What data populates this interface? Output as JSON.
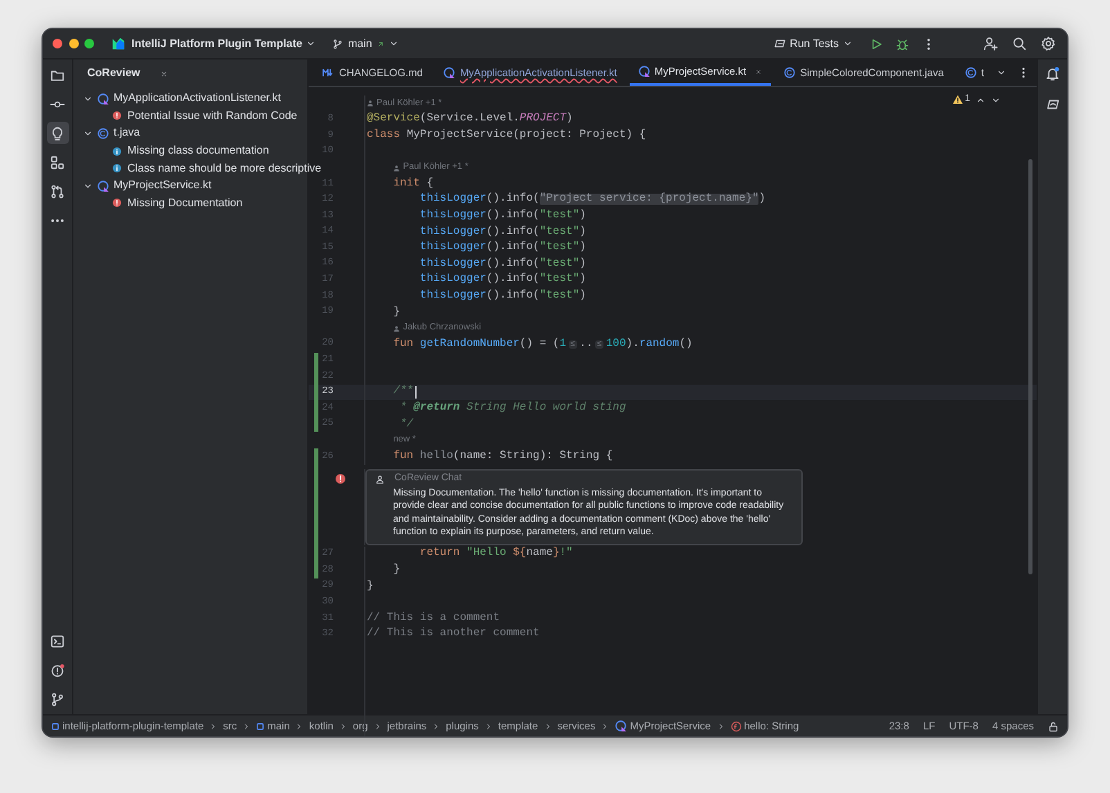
{
  "window": {
    "project": "IntelliJ Platform Plugin Template",
    "branch": "main",
    "run_config": "Run Tests"
  },
  "left_stripe": {
    "top": [
      {
        "kind": "folder",
        "selected": false
      },
      {
        "kind": "commit",
        "selected": false
      },
      {
        "kind": "bulb",
        "selected": true
      },
      {
        "kind": "structure",
        "selected": false
      },
      {
        "kind": "pull",
        "selected": false
      },
      {
        "kind": "more",
        "selected": false
      }
    ],
    "bottom": [
      {
        "kind": "terminal",
        "selected": false
      },
      {
        "kind": "problems",
        "selected": false
      },
      {
        "kind": "git",
        "selected": false
      }
    ]
  },
  "tool_window": {
    "title": "CoReview",
    "tree": [
      {
        "label": "MyApplicationActivationListener.kt",
        "kind": "kotlin",
        "expanded": true,
        "children": [
          {
            "label": "Potential Issue with Random Code",
            "kind": "error"
          }
        ]
      },
      {
        "label": "t.java",
        "kind": "java",
        "expanded": true,
        "children": [
          {
            "label": "Missing class documentation",
            "kind": "info"
          },
          {
            "label": "Class name should be more descriptive",
            "kind": "info"
          }
        ]
      },
      {
        "label": "MyProjectService.kt",
        "kind": "kotlin",
        "expanded": true,
        "children": [
          {
            "label": "Missing Documentation",
            "kind": "error"
          }
        ]
      }
    ]
  },
  "tabs": [
    {
      "label": "CHANGELOG.md",
      "kind": "markdown",
      "selected": false,
      "has_error": false
    },
    {
      "label": "MyApplicationActivationListener.kt",
      "kind": "kotlin",
      "selected": false,
      "has_error": true
    },
    {
      "label": "MyProjectService.kt",
      "kind": "kotlin",
      "selected": true,
      "has_error": false
    },
    {
      "label": "SimpleColoredComponent.java",
      "kind": "java",
      "selected": false,
      "has_error": false
    },
    {
      "label": "t",
      "kind": "java",
      "selected": false,
      "has_error": false
    }
  ],
  "editor": {
    "warnings": "1",
    "lines": [
      {
        "kind": "author",
        "text": "Paul Köhler +1 *"
      },
      {
        "kind": "code",
        "number": "8",
        "changed": false,
        "current": false,
        "tokens": [
          {
            "text": "@Service",
            "kind": "annotation"
          },
          {
            "text": "(Service.Level.",
            "kind": "plain"
          },
          {
            "text": "PROJECT",
            "kind": "constant"
          },
          {
            "text": ")",
            "kind": "plain"
          }
        ]
      },
      {
        "kind": "code",
        "number": "9",
        "changed": false,
        "current": false,
        "tokens": [
          {
            "text": "class ",
            "kind": "keyword"
          },
          {
            "text": "MyProjectService(project: Project) {",
            "kind": "plain"
          }
        ]
      },
      {
        "kind": "code",
        "number": "10",
        "changed": false,
        "current": false
      },
      {
        "kind": "author",
        "text": "Paul Köhler +1 *"
      },
      {
        "kind": "code",
        "number": "11",
        "changed": false,
        "current": false,
        "tokens": [
          {
            "text": "    init ",
            "kind": "keyword"
          },
          {
            "text": "{",
            "kind": "plain"
          }
        ]
      },
      {
        "kind": "code",
        "number": "12",
        "changed": false,
        "current": false,
        "tokens": [
          {
            "text": "        thisLogger",
            "kind": "call"
          },
          {
            "text": "().info(",
            "kind": "plain"
          },
          {
            "text": "\"Project service: {project.name}\"",
            "kind": "string-hl"
          },
          {
            "text": ")",
            "kind": "plain"
          }
        ]
      },
      {
        "kind": "code",
        "number": "13",
        "changed": false,
        "current": false,
        "tokens": [
          {
            "text": "        thisLogger",
            "kind": "call"
          },
          {
            "text": "().info(",
            "kind": "plain"
          },
          {
            "text": "\"test\"",
            "kind": "string"
          },
          {
            "text": ")",
            "kind": "plain"
          }
        ]
      },
      {
        "kind": "code",
        "number": "14",
        "changed": false,
        "current": false,
        "tokens": [
          {
            "text": "        thisLogger",
            "kind": "call"
          },
          {
            "text": "().info(",
            "kind": "plain"
          },
          {
            "text": "\"test\"",
            "kind": "string"
          },
          {
            "text": ")",
            "kind": "plain"
          }
        ]
      },
      {
        "kind": "code",
        "number": "15",
        "changed": false,
        "current": false,
        "tokens": [
          {
            "text": "        thisLogger",
            "kind": "call"
          },
          {
            "text": "().info(",
            "kind": "plain"
          },
          {
            "text": "\"test\"",
            "kind": "string"
          },
          {
            "text": ")",
            "kind": "plain"
          }
        ]
      },
      {
        "kind": "code",
        "number": "16",
        "changed": false,
        "current": false,
        "tokens": [
          {
            "text": "        thisLogger",
            "kind": "call"
          },
          {
            "text": "().info(",
            "kind": "plain"
          },
          {
            "text": "\"test\"",
            "kind": "string"
          },
          {
            "text": ")",
            "kind": "plain"
          }
        ]
      },
      {
        "kind": "code",
        "number": "17",
        "changed": false,
        "current": false,
        "tokens": [
          {
            "text": "        thisLogger",
            "kind": "call"
          },
          {
            "text": "().info(",
            "kind": "plain"
          },
          {
            "text": "\"test\"",
            "kind": "string"
          },
          {
            "text": ")",
            "kind": "plain"
          }
        ]
      },
      {
        "kind": "code",
        "number": "18",
        "changed": false,
        "current": false,
        "tokens": [
          {
            "text": "        thisLogger",
            "kind": "call"
          },
          {
            "text": "().info(",
            "kind": "plain"
          },
          {
            "text": "\"test\"",
            "kind": "string"
          },
          {
            "text": ")",
            "kind": "plain"
          }
        ]
      },
      {
        "kind": "code",
        "number": "19",
        "changed": false,
        "current": false,
        "tokens": [
          {
            "text": "    }",
            "kind": "plain"
          }
        ]
      },
      {
        "kind": "author",
        "text": "Jakub Chrzanowski"
      },
      {
        "kind": "code",
        "number": "20",
        "changed": false,
        "current": false,
        "tokens": [
          {
            "text": "    fun ",
            "kind": "keyword"
          },
          {
            "text": "getRandomNumber",
            "kind": "call"
          },
          {
            "text": "() = (",
            "kind": "plain"
          },
          {
            "text": "1",
            "kind": "number"
          },
          {
            "text": "≤",
            "kind": "hint"
          },
          {
            "text": "..",
            "kind": "plain"
          },
          {
            "text": "≤",
            "kind": "hint"
          },
          {
            "text": "100",
            "kind": "number"
          },
          {
            "text": ").",
            "kind": "plain"
          },
          {
            "text": "random",
            "kind": "call"
          },
          {
            "text": "()",
            "kind": "plain"
          }
        ]
      },
      {
        "kind": "code",
        "number": "21",
        "changed": true,
        "current": false
      },
      {
        "kind": "code",
        "number": "22",
        "changed": true,
        "current": false
      },
      {
        "kind": "code",
        "number": "23",
        "changed": true,
        "current": true,
        "tokens": [
          {
            "text": "    /**",
            "kind": "doc"
          }
        ]
      },
      {
        "kind": "code",
        "number": "24",
        "changed": true,
        "current": false,
        "tokens": [
          {
            "text": "     * ",
            "kind": "doc"
          },
          {
            "text": "@return",
            "kind": "doc-tag"
          },
          {
            "text": " String Hello world sting",
            "kind": "doc"
          }
        ]
      },
      {
        "kind": "code",
        "number": "25",
        "changed": true,
        "current": false,
        "tokens": [
          {
            "text": "     */",
            "kind": "doc"
          }
        ]
      },
      {
        "kind": "note",
        "text": "new *"
      },
      {
        "kind": "code",
        "number": "26",
        "changed": true,
        "current": false,
        "tokens": [
          {
            "text": "    fun ",
            "kind": "keyword"
          },
          {
            "text": "hello",
            "kind": "unused"
          },
          {
            "text": "(name: String): String {",
            "kind": "plain"
          }
        ]
      },
      {
        "kind": "review",
        "has_error": true,
        "title": "CoReview Chat",
        "text": "Missing Documentation. The 'hello' function is missing documentation. It's important to provide clear and concise documentation for all public functions to improve code readability and maintainability. Consider adding a documentation comment (KDoc) above the 'hello' function to explain its purpose, parameters, and return value."
      },
      {
        "kind": "code",
        "number": "27",
        "changed": true,
        "current": false,
        "tokens": [
          {
            "text": "        return ",
            "kind": "keyword"
          },
          {
            "text": "\"Hello ",
            "kind": "string"
          },
          {
            "text": "${",
            "kind": "keyword"
          },
          {
            "text": "name",
            "kind": "plain"
          },
          {
            "text": "}",
            "kind": "keyword"
          },
          {
            "text": "!\"",
            "kind": "string"
          }
        ]
      },
      {
        "kind": "code",
        "number": "28",
        "changed": true,
        "current": false,
        "tokens": [
          {
            "text": "    }",
            "kind": "plain"
          }
        ]
      },
      {
        "kind": "code",
        "number": "29",
        "changed": false,
        "current": false,
        "tokens": [
          {
            "text": "}",
            "kind": "plain"
          }
        ]
      },
      {
        "kind": "code",
        "number": "30",
        "changed": false,
        "current": false
      },
      {
        "kind": "code",
        "number": "31",
        "changed": false,
        "current": false,
        "tokens": [
          {
            "text": "// This is a comment",
            "kind": "comment"
          }
        ]
      },
      {
        "kind": "code",
        "number": "32",
        "changed": false,
        "current": false,
        "tokens": [
          {
            "text": "// This is another comment",
            "kind": "comment"
          }
        ]
      }
    ]
  },
  "status_bar": {
    "breadcrumbs": [
      {
        "text": "intellij-platform-plugin-template",
        "kind": "module"
      },
      {
        "text": "src",
        "kind": "plain"
      },
      {
        "text": "main",
        "kind": "module"
      },
      {
        "text": "kotlin",
        "kind": "plain"
      },
      {
        "text": "org",
        "kind": "plain"
      },
      {
        "text": "jetbrains",
        "kind": "plain"
      },
      {
        "text": "plugins",
        "kind": "plain"
      },
      {
        "text": "template",
        "kind": "plain"
      },
      {
        "text": "services",
        "kind": "plain"
      },
      {
        "text": "MyProjectService",
        "kind": "class"
      },
      {
        "text": "hello: String",
        "kind": "function"
      }
    ],
    "items": [
      "23:8",
      "LF",
      "UTF-8",
      "4 spaces"
    ]
  }
}
